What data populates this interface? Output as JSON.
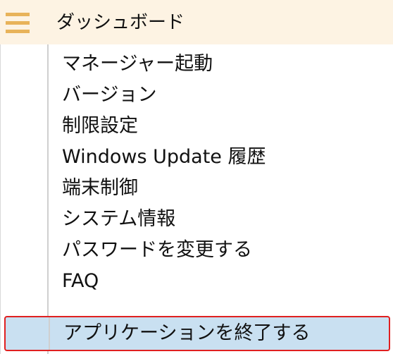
{
  "header": {
    "menu_icon": "hamburger-icon",
    "title": "ダッシュボード"
  },
  "menu": {
    "items": [
      {
        "label": "マネージャー起動"
      },
      {
        "label": "バージョン"
      },
      {
        "label": "制限設定"
      },
      {
        "label": "Windows Update 履歴"
      },
      {
        "label": "端末制御"
      },
      {
        "label": "システム情報"
      },
      {
        "label": "パスワードを変更する"
      },
      {
        "label": "FAQ"
      },
      {
        "label": "アプリケーションを終了する",
        "selected": true
      }
    ]
  },
  "colors": {
    "header_bg": "#fdf3e3",
    "hamburger": "#e8b35a",
    "selected_bg": "#c9e0f1",
    "selected_border": "#e02020"
  }
}
